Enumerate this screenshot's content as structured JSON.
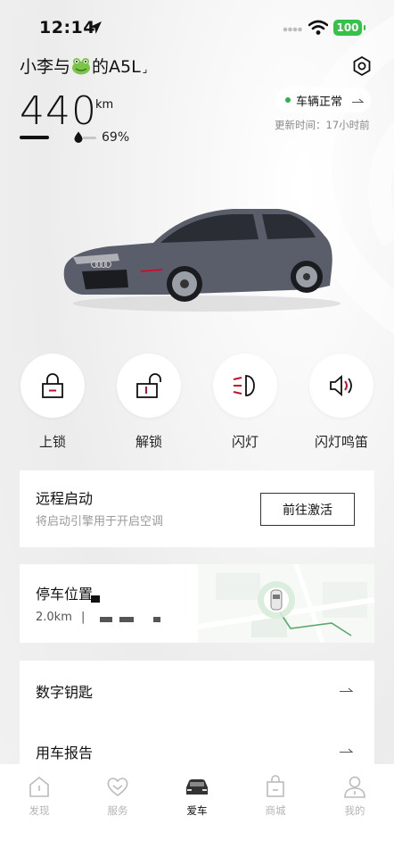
{
  "status_bar": {
    "time": "12:14",
    "battery": "100"
  },
  "header": {
    "car_name_prefix": "小李与",
    "car_name_suffix": "的A5L",
    "caret": "⌟"
  },
  "range": {
    "value": "440",
    "unit": "km",
    "battery_percent": "69%",
    "battery_level": 0.69
  },
  "vehicle_status": {
    "label": "车辆正常",
    "update_time": "更新时间：17小时前"
  },
  "actions": [
    {
      "label": "上锁",
      "icon": "lock-icon"
    },
    {
      "label": "解锁",
      "icon": "unlock-icon"
    },
    {
      "label": "闪灯",
      "icon": "headlight-icon"
    },
    {
      "label": "闪灯鸣笛",
      "icon": "horn-icon"
    }
  ],
  "remote_start": {
    "title": "远程启动",
    "subtitle": "将启动引擎用于开启空调",
    "button": "前往激活"
  },
  "parking": {
    "title": "停车位置",
    "distance": "2.0km",
    "separator": "|"
  },
  "list": [
    {
      "label": "数字钥匙"
    },
    {
      "label": "用车报告"
    }
  ],
  "tabs": [
    {
      "label": "发现",
      "icon": "home-icon",
      "active": false
    },
    {
      "label": "服务",
      "icon": "heart-icon",
      "active": false
    },
    {
      "label": "爱车",
      "icon": "car-icon",
      "active": true
    },
    {
      "label": "商城",
      "icon": "shopping-bag-icon",
      "active": false
    },
    {
      "label": "我的",
      "icon": "person-icon",
      "active": false
    }
  ],
  "colors": {
    "accent_red": "#c8102e",
    "status_green": "#2fb24a",
    "battery_green": "#36c24a"
  }
}
